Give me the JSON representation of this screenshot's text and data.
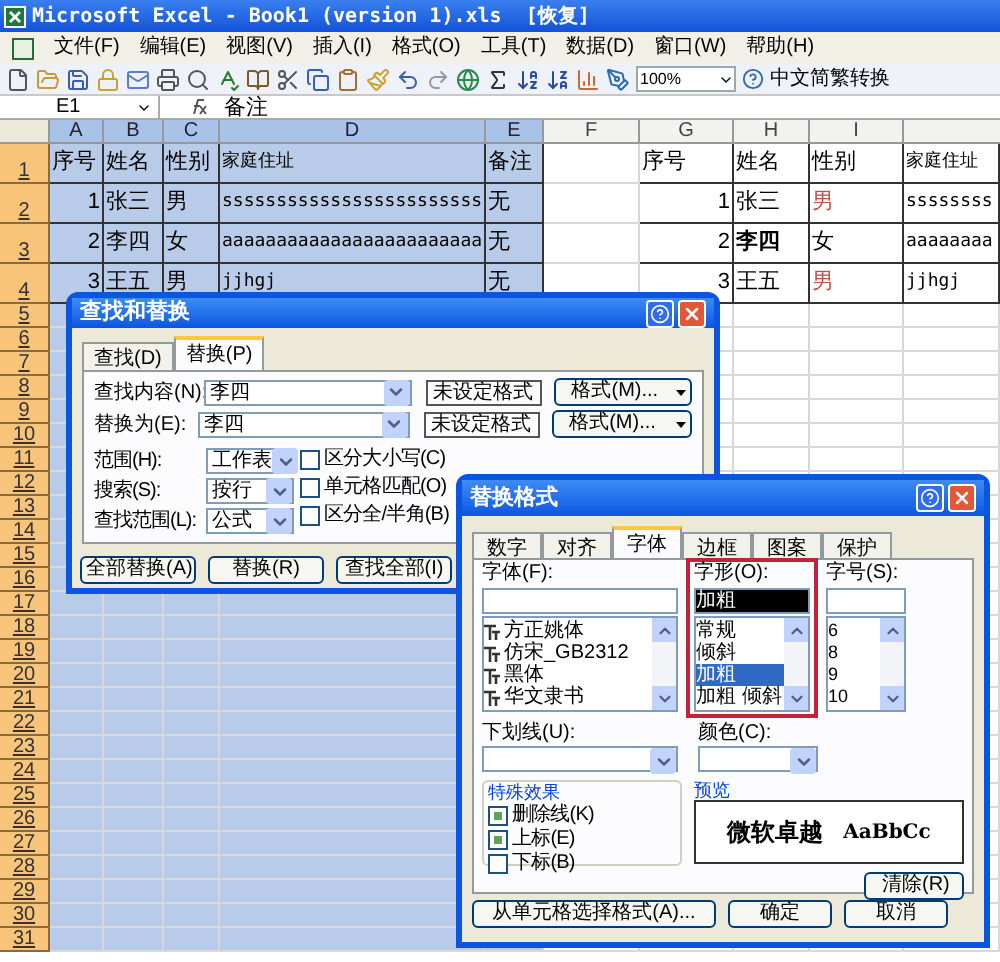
{
  "window": {
    "title": "Microsoft Excel - Book1 (version 1).xls  [恢复]"
  },
  "menu": [
    "文件(F)",
    "编辑(E)",
    "视图(V)",
    "插入(I)",
    "格式(O)",
    "工具(T)",
    "数据(D)",
    "窗口(W)",
    "帮助(H)"
  ],
  "toolbar": {
    "zoom": "100%",
    "convert_button": "中文简繁转换"
  },
  "formula_bar": {
    "name_box": "E1",
    "content": "备注"
  },
  "sheet": {
    "columns": [
      {
        "label": "A",
        "selected": true
      },
      {
        "label": "B",
        "selected": true
      },
      {
        "label": "C",
        "selected": true
      },
      {
        "label": "D",
        "selected": true
      },
      {
        "label": "E",
        "selected": true
      },
      {
        "label": "F",
        "selected": false
      },
      {
        "label": "G",
        "selected": false
      },
      {
        "label": "H",
        "selected": false
      },
      {
        "label": "I",
        "selected": false
      }
    ],
    "row_headers": [
      "1",
      "2",
      "3",
      "4",
      "5",
      "6",
      "7",
      "8",
      "9",
      "10",
      "11",
      "12",
      "13",
      "14",
      "15",
      "16",
      "17",
      "18",
      "19",
      "20",
      "21",
      "22",
      "23",
      "24",
      "25",
      "26",
      "27",
      "28",
      "29",
      "30",
      "31"
    ],
    "left_table": [
      [
        "序号",
        "姓名",
        "性别",
        "家庭住址",
        "备注"
      ],
      [
        "1",
        "张三",
        "男",
        "ssssssssssssssssssssssss",
        "无"
      ],
      [
        "2",
        "李四",
        "女",
        "aaaaaaaaaaaaaaaaaaaaaaaa",
        "无"
      ],
      [
        "3",
        "王五",
        "男",
        "jjhgj",
        "无"
      ]
    ],
    "right_table": [
      [
        {
          "text": "序号"
        },
        {
          "text": "姓名"
        },
        {
          "text": "性别"
        },
        {
          "text": "家庭住址"
        }
      ],
      [
        {
          "text": "1"
        },
        {
          "text": "张三"
        },
        {
          "text": "男",
          "color": "#c0504d"
        },
        {
          "text": "ssssssss"
        }
      ],
      [
        {
          "text": "2"
        },
        {
          "text": "李四",
          "bold": true
        },
        {
          "text": "女"
        },
        {
          "text": "aaaaaaaa"
        }
      ],
      [
        {
          "text": "3"
        },
        {
          "text": "王五"
        },
        {
          "text": "男",
          "color": "#c0504d"
        },
        {
          "text": "jjhgj"
        }
      ]
    ]
  },
  "find_dialog": {
    "title": "查找和替换",
    "tabs": [
      {
        "label": "查找(D)",
        "selected": false
      },
      {
        "label": "替换(P)",
        "selected": true
      }
    ],
    "fields": [
      {
        "label": "查找内容(N):",
        "value": "李四",
        "format_status": "未设定格式",
        "format_button": "格式(M)..."
      },
      {
        "label": "替换为(E):",
        "value": "李四",
        "format_status": "未设定格式",
        "format_button": "格式(M)..."
      }
    ],
    "options": [
      {
        "label": "范围(H):",
        "value": "工作表"
      },
      {
        "label": "搜索(S):",
        "value": "按行"
      },
      {
        "label": "查找范围(L):",
        "value": "公式"
      }
    ],
    "checkboxes": [
      {
        "label": "区分大小写(C)",
        "checked": false
      },
      {
        "label": "单元格匹配(O)",
        "checked": false
      },
      {
        "label": "区分全/半角(B)",
        "checked": false
      }
    ],
    "buttons": [
      "全部替换(A)",
      "替换(R)",
      "查找全部(I)"
    ]
  },
  "format_dialog": {
    "title": "替换格式",
    "tabs": [
      {
        "label": "数字",
        "selected": false
      },
      {
        "label": "对齐",
        "selected": false
      },
      {
        "label": "字体",
        "selected": true
      },
      {
        "label": "边框",
        "selected": false
      },
      {
        "label": "图案",
        "selected": false
      },
      {
        "label": "保护",
        "selected": false
      }
    ],
    "font": {
      "label": "字体(F):",
      "items": [
        "方正姚体",
        "仿宋_GB2312",
        "黑体",
        "华文隶书"
      ]
    },
    "style": {
      "label": "字形(O):",
      "value": "加粗",
      "items": [
        {
          "label": "常规",
          "selected": false
        },
        {
          "label": "倾斜",
          "selected": false
        },
        {
          "label": "加粗",
          "selected": true
        },
        {
          "label": "加粗 倾斜",
          "selected": false
        }
      ]
    },
    "size": {
      "label": "字号(S):",
      "items": [
        "6",
        "8",
        "9",
        "10"
      ]
    },
    "underline": {
      "label": "下划线(U):"
    },
    "color": {
      "label": "颜色(C):"
    },
    "effects": {
      "title": "特殊效果",
      "items": [
        {
          "label": "删除线(K)",
          "checked": true
        },
        {
          "label": "上标(E)",
          "checked": true
        },
        {
          "label": "下标(B)",
          "checked": false
        }
      ]
    },
    "preview": {
      "title": "预览",
      "sample_cjk": "微软卓越",
      "sample_latin": "AaBbCc"
    },
    "clear_button": "清除(R)",
    "buttons": [
      "从单元格选择格式(A)...",
      "确定",
      "取消"
    ]
  }
}
